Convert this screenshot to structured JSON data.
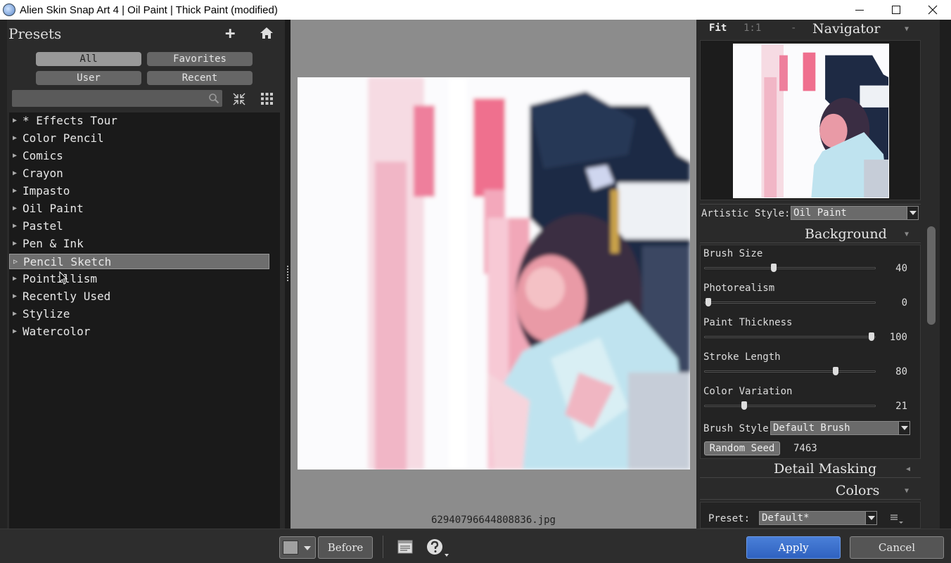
{
  "window": {
    "title": "Alien Skin Snap Art 4 | Oil Paint | Thick Paint (modified)"
  },
  "presets": {
    "title": "Presets",
    "tabs": [
      "All",
      "Favorites",
      "User",
      "Recent"
    ],
    "active_tab": "All",
    "search_placeholder": "",
    "items": [
      "* Effects Tour",
      "Color Pencil",
      "Comics",
      "Crayon",
      "Impasto",
      "Oil Paint",
      "Pastel",
      "Pen & Ink",
      "Pencil Sketch",
      "Pointillism",
      "Recently Used",
      "Stylize",
      "Watercolor"
    ],
    "selected_item": "Pencil Sketch"
  },
  "canvas": {
    "filename": "62940796644808836.jpg"
  },
  "navigator": {
    "fit": "Fit",
    "one_to_one": "1:1",
    "dash": "-",
    "title": "Navigator"
  },
  "artistic_style": {
    "label": "Artistic Style:",
    "value": "Oil Paint"
  },
  "background": {
    "title": "Background",
    "sliders": [
      {
        "label": "Brush Size",
        "value": 40,
        "fraction": 0.4
      },
      {
        "label": "Photorealism",
        "value": 0,
        "fraction": 0.0
      },
      {
        "label": "Paint Thickness",
        "value": 100,
        "fraction": 1.0
      },
      {
        "label": "Stroke Length",
        "value": 80,
        "fraction": 0.78
      },
      {
        "label": "Color Variation",
        "value": 21,
        "fraction": 0.22
      }
    ],
    "brush_style_label": "Brush Style",
    "brush_style_value": "Default Brush",
    "random_seed_label": "Random Seed",
    "random_seed_value": "7463"
  },
  "detail_masking": {
    "title": "Detail Masking"
  },
  "colors": {
    "title": "Colors",
    "preset_label": "Preset:",
    "preset_value": "Default*"
  },
  "toolbar": {
    "before_label": "Before",
    "apply_label": "Apply",
    "cancel_label": "Cancel"
  },
  "theme": {
    "accent": "#3b6fcc",
    "panel": "#2b2b2b",
    "canvas_bg": "#8c8c8c"
  }
}
